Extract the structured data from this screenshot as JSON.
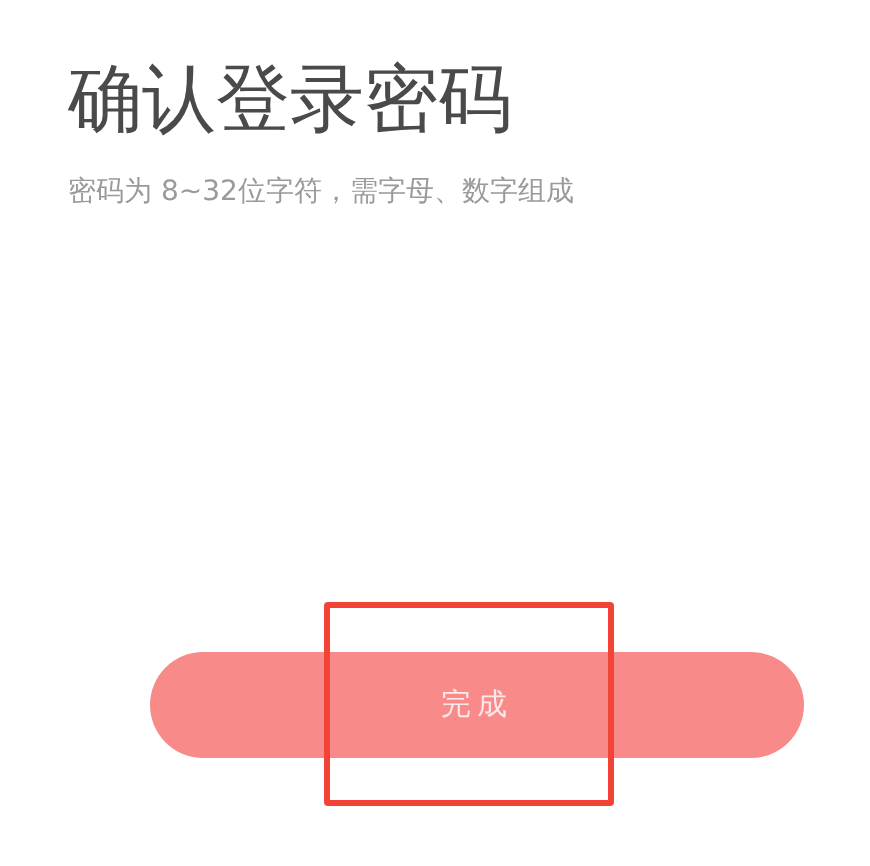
{
  "title": "确认登录密码",
  "hint": "密码为 8~32位字符，需字母、数字组成",
  "submit_button": {
    "label": "完成",
    "disabled": true
  }
}
